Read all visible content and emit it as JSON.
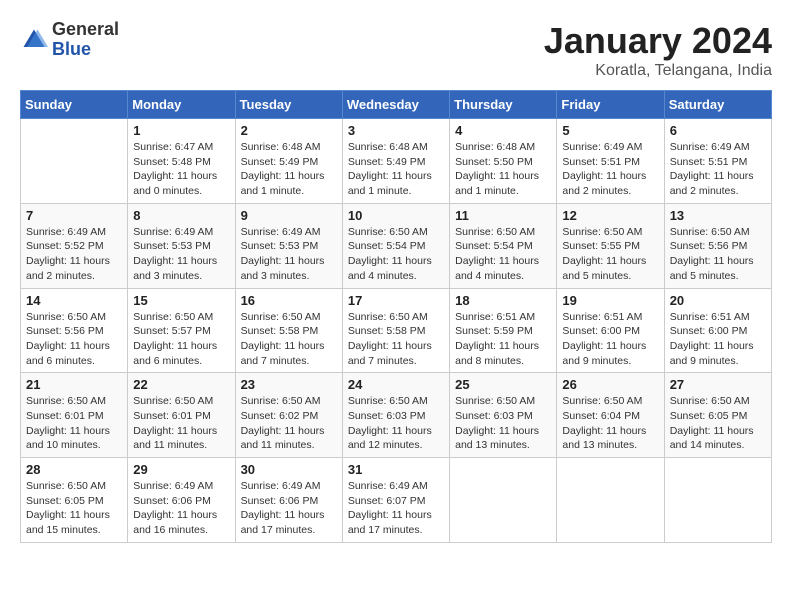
{
  "header": {
    "logo_general": "General",
    "logo_blue": "Blue",
    "title": "January 2024",
    "subtitle": "Koratla, Telangana, India"
  },
  "days_of_week": [
    "Sunday",
    "Monday",
    "Tuesday",
    "Wednesday",
    "Thursday",
    "Friday",
    "Saturday"
  ],
  "weeks": [
    [
      {
        "day": "",
        "info": ""
      },
      {
        "day": "1",
        "info": "Sunrise: 6:47 AM\nSunset: 5:48 PM\nDaylight: 11 hours\nand 0 minutes."
      },
      {
        "day": "2",
        "info": "Sunrise: 6:48 AM\nSunset: 5:49 PM\nDaylight: 11 hours\nand 1 minute."
      },
      {
        "day": "3",
        "info": "Sunrise: 6:48 AM\nSunset: 5:49 PM\nDaylight: 11 hours\nand 1 minute."
      },
      {
        "day": "4",
        "info": "Sunrise: 6:48 AM\nSunset: 5:50 PM\nDaylight: 11 hours\nand 1 minute."
      },
      {
        "day": "5",
        "info": "Sunrise: 6:49 AM\nSunset: 5:51 PM\nDaylight: 11 hours\nand 2 minutes."
      },
      {
        "day": "6",
        "info": "Sunrise: 6:49 AM\nSunset: 5:51 PM\nDaylight: 11 hours\nand 2 minutes."
      }
    ],
    [
      {
        "day": "7",
        "info": "Sunrise: 6:49 AM\nSunset: 5:52 PM\nDaylight: 11 hours\nand 2 minutes."
      },
      {
        "day": "8",
        "info": "Sunrise: 6:49 AM\nSunset: 5:53 PM\nDaylight: 11 hours\nand 3 minutes."
      },
      {
        "day": "9",
        "info": "Sunrise: 6:49 AM\nSunset: 5:53 PM\nDaylight: 11 hours\nand 3 minutes."
      },
      {
        "day": "10",
        "info": "Sunrise: 6:50 AM\nSunset: 5:54 PM\nDaylight: 11 hours\nand 4 minutes."
      },
      {
        "day": "11",
        "info": "Sunrise: 6:50 AM\nSunset: 5:54 PM\nDaylight: 11 hours\nand 4 minutes."
      },
      {
        "day": "12",
        "info": "Sunrise: 6:50 AM\nSunset: 5:55 PM\nDaylight: 11 hours\nand 5 minutes."
      },
      {
        "day": "13",
        "info": "Sunrise: 6:50 AM\nSunset: 5:56 PM\nDaylight: 11 hours\nand 5 minutes."
      }
    ],
    [
      {
        "day": "14",
        "info": "Sunrise: 6:50 AM\nSunset: 5:56 PM\nDaylight: 11 hours\nand 6 minutes."
      },
      {
        "day": "15",
        "info": "Sunrise: 6:50 AM\nSunset: 5:57 PM\nDaylight: 11 hours\nand 6 minutes."
      },
      {
        "day": "16",
        "info": "Sunrise: 6:50 AM\nSunset: 5:58 PM\nDaylight: 11 hours\nand 7 minutes."
      },
      {
        "day": "17",
        "info": "Sunrise: 6:50 AM\nSunset: 5:58 PM\nDaylight: 11 hours\nand 7 minutes."
      },
      {
        "day": "18",
        "info": "Sunrise: 6:51 AM\nSunset: 5:59 PM\nDaylight: 11 hours\nand 8 minutes."
      },
      {
        "day": "19",
        "info": "Sunrise: 6:51 AM\nSunset: 6:00 PM\nDaylight: 11 hours\nand 9 minutes."
      },
      {
        "day": "20",
        "info": "Sunrise: 6:51 AM\nSunset: 6:00 PM\nDaylight: 11 hours\nand 9 minutes."
      }
    ],
    [
      {
        "day": "21",
        "info": "Sunrise: 6:50 AM\nSunset: 6:01 PM\nDaylight: 11 hours\nand 10 minutes."
      },
      {
        "day": "22",
        "info": "Sunrise: 6:50 AM\nSunset: 6:01 PM\nDaylight: 11 hours\nand 11 minutes."
      },
      {
        "day": "23",
        "info": "Sunrise: 6:50 AM\nSunset: 6:02 PM\nDaylight: 11 hours\nand 11 minutes."
      },
      {
        "day": "24",
        "info": "Sunrise: 6:50 AM\nSunset: 6:03 PM\nDaylight: 11 hours\nand 12 minutes."
      },
      {
        "day": "25",
        "info": "Sunrise: 6:50 AM\nSunset: 6:03 PM\nDaylight: 11 hours\nand 13 minutes."
      },
      {
        "day": "26",
        "info": "Sunrise: 6:50 AM\nSunset: 6:04 PM\nDaylight: 11 hours\nand 13 minutes."
      },
      {
        "day": "27",
        "info": "Sunrise: 6:50 AM\nSunset: 6:05 PM\nDaylight: 11 hours\nand 14 minutes."
      }
    ],
    [
      {
        "day": "28",
        "info": "Sunrise: 6:50 AM\nSunset: 6:05 PM\nDaylight: 11 hours\nand 15 minutes."
      },
      {
        "day": "29",
        "info": "Sunrise: 6:49 AM\nSunset: 6:06 PM\nDaylight: 11 hours\nand 16 minutes."
      },
      {
        "day": "30",
        "info": "Sunrise: 6:49 AM\nSunset: 6:06 PM\nDaylight: 11 hours\nand 17 minutes."
      },
      {
        "day": "31",
        "info": "Sunrise: 6:49 AM\nSunset: 6:07 PM\nDaylight: 11 hours\nand 17 minutes."
      },
      {
        "day": "",
        "info": ""
      },
      {
        "day": "",
        "info": ""
      },
      {
        "day": "",
        "info": ""
      }
    ]
  ]
}
